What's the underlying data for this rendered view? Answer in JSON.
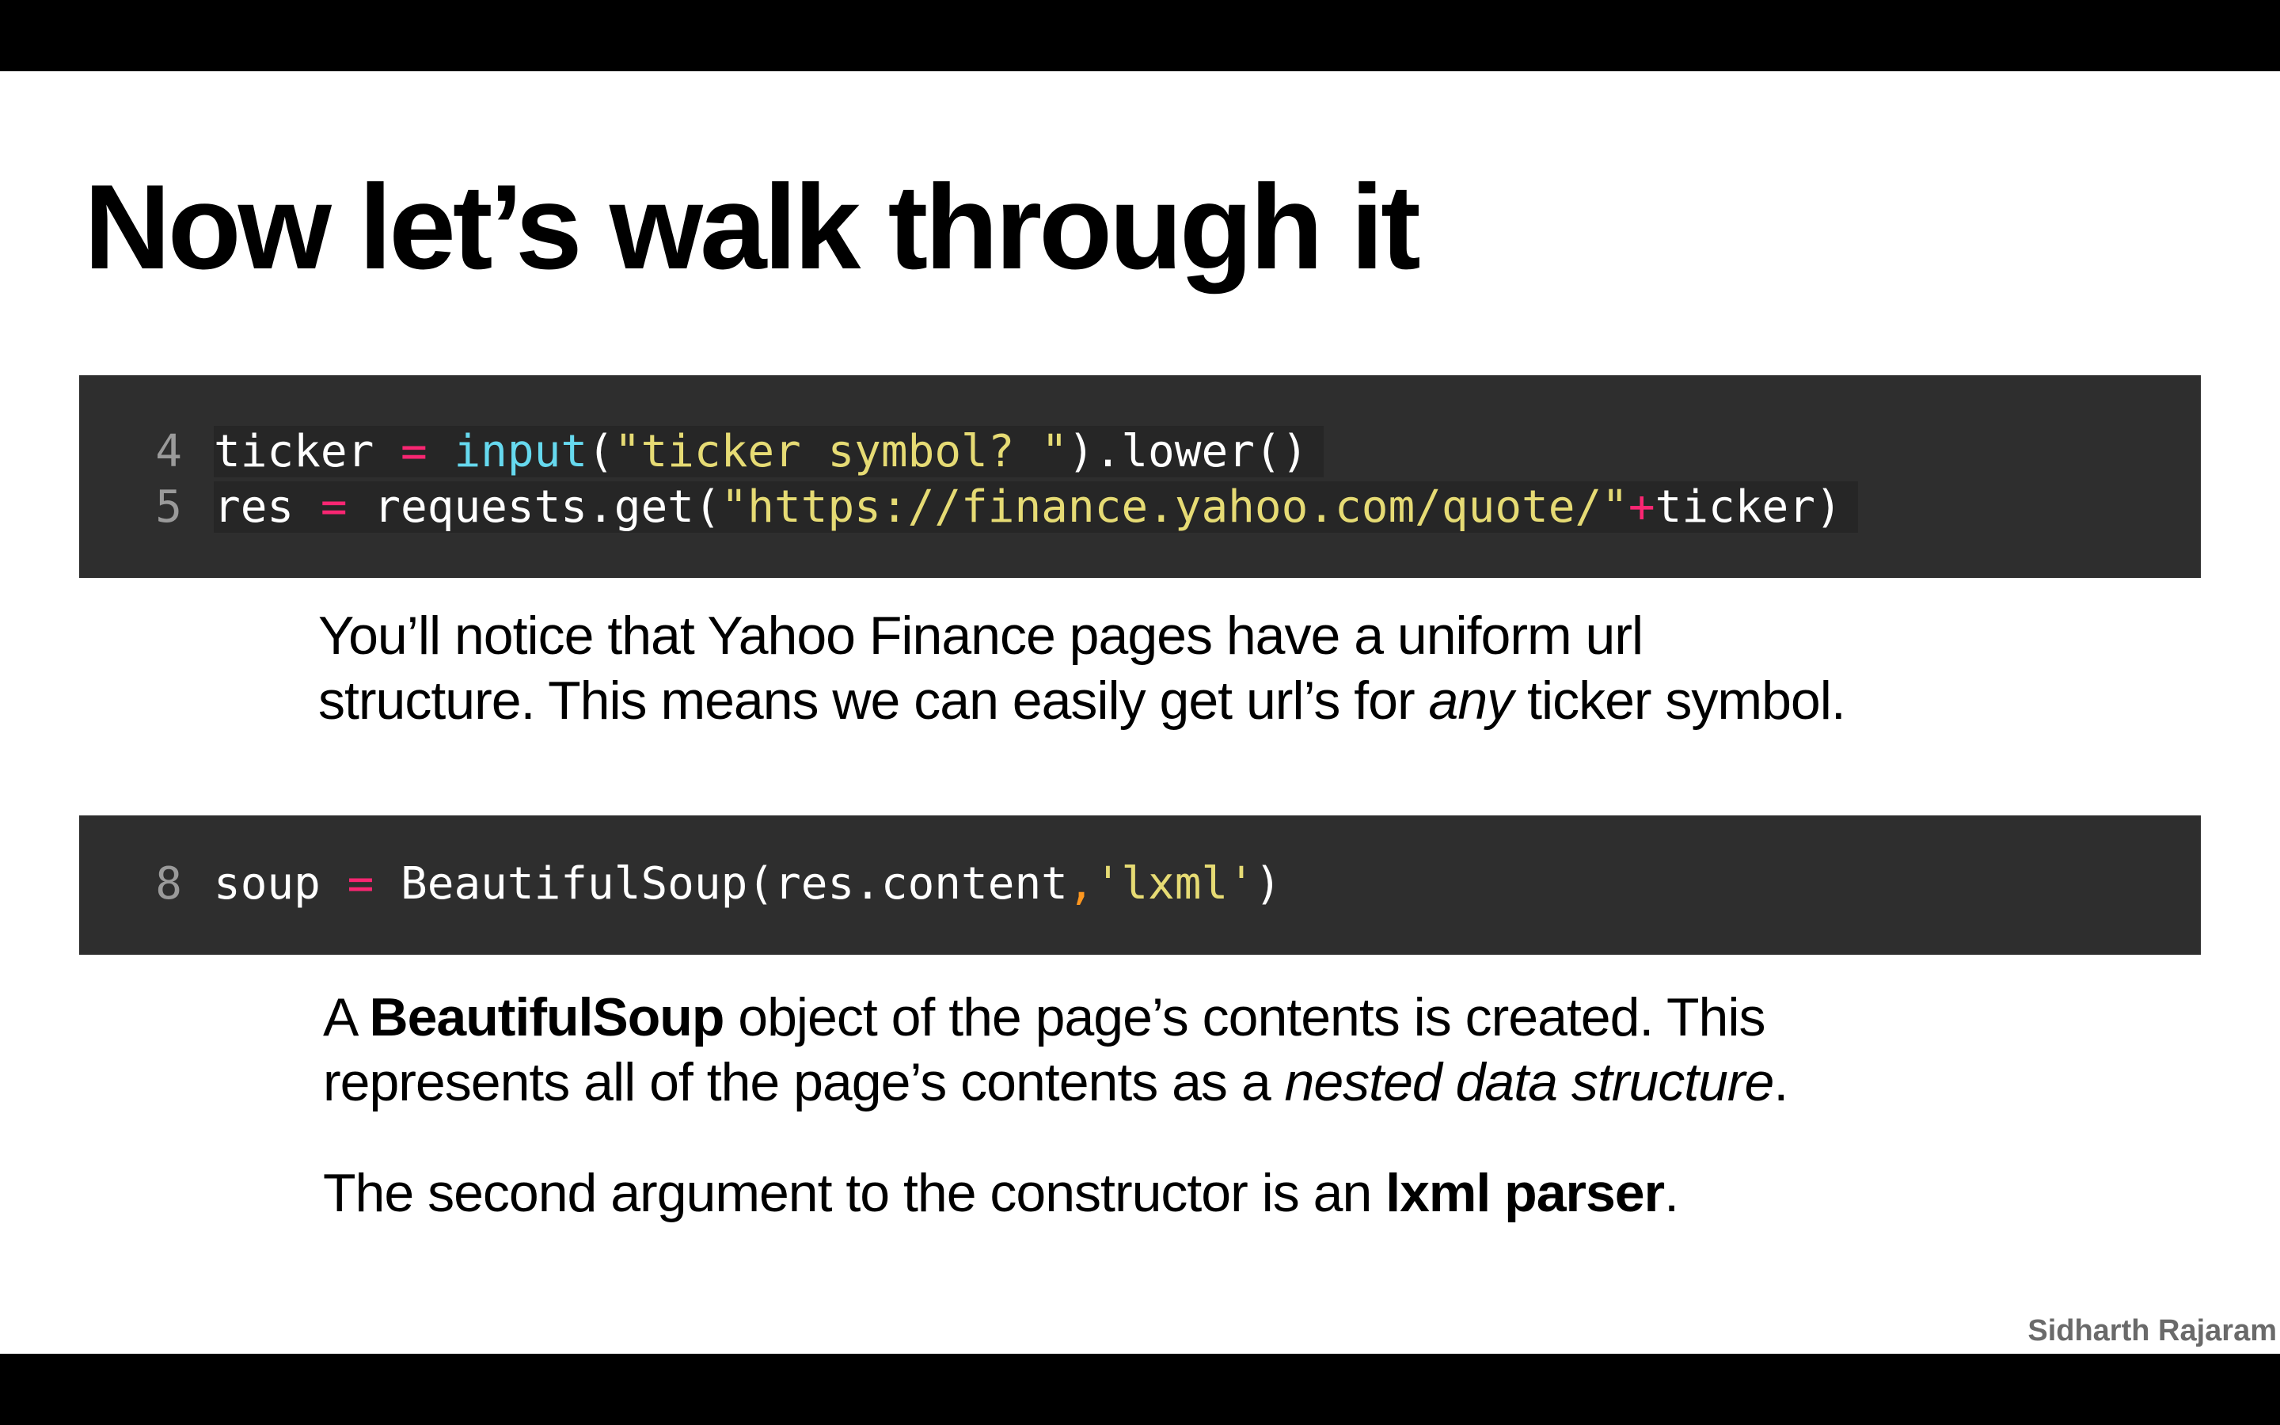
{
  "slide": {
    "title": "Now let’s walk through it",
    "author": "Sidharth Rajaram"
  },
  "code_blocks": [
    {
      "lines": [
        {
          "number": "4",
          "tokens": [
            "ticker ",
            "=",
            " ",
            "input",
            "(",
            "\"ticker symbol? \"",
            ").lower()"
          ]
        },
        {
          "number": "5",
          "tokens": [
            "res ",
            "=",
            " requests.get(",
            "\"https://finance.yahoo.com/quote/\"",
            "+",
            "ticker)"
          ]
        }
      ]
    },
    {
      "lines": [
        {
          "number": "8",
          "tokens": [
            "soup ",
            "=",
            " BeautifulSoup(res.content",
            ",",
            "'lxml'",
            ")"
          ]
        }
      ]
    }
  ],
  "explanations": {
    "first": {
      "line1": "You’ll notice that Yahoo Finance pages have a uniform url",
      "line2_pre": "structure. This means we can easily get url’s for ",
      "line2_em": "any",
      "line2_post": " ticker symbol."
    },
    "second": {
      "line1_pre": "A ",
      "line1_strong": "BeautifulSoup",
      "line1_post": " object of the page’s contents is created. This",
      "line2_pre": "represents all of the page’s contents as a ",
      "line2_em": "nested data structure",
      "line2_post": "."
    },
    "third": {
      "pre": "The second argument to the constructor is an ",
      "strong": "lxml parser",
      "post": "."
    }
  },
  "colors": {
    "code_background": "#2e2e2e",
    "keyword_operator": "#f92672",
    "builtin": "#66d9ef",
    "string": "#e6db74",
    "punctuation": "#fd971f",
    "line_number": "#9a9a9a",
    "author_text": "#6a6a6a"
  }
}
